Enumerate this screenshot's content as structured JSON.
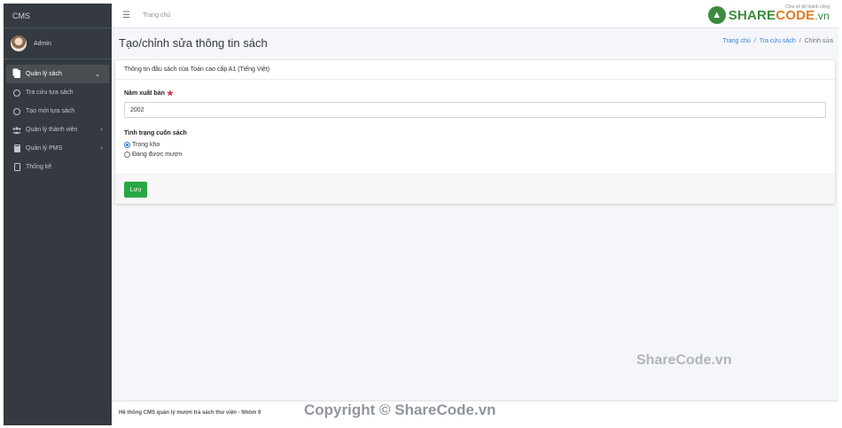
{
  "sidebar": {
    "brand": "CMS",
    "user_name": "Admin",
    "items": [
      {
        "label": "Quản lý sách",
        "icon": "books-icon",
        "active": true,
        "caret": "⌄"
      },
      {
        "label": "Tra cứu tựa sách",
        "icon": "circle-icon"
      },
      {
        "label": "Tạo mới tựa sách",
        "icon": "circle-icon"
      },
      {
        "label": "Quản lý thành viên",
        "icon": "users-icon",
        "caret": "‹"
      },
      {
        "label": "Quản lý PMS",
        "icon": "book-icon",
        "caret": "‹"
      },
      {
        "label": "Thống kê",
        "icon": "file-icon"
      }
    ]
  },
  "topbar": {
    "menu_icon": "hamburger-icon",
    "home_link": "Trang chủ",
    "logo": {
      "share": "SHARE",
      "code": "CODE",
      "vn": ".vn",
      "sub": "Chia sẻ để thành công"
    }
  },
  "content": {
    "title": "Tạo/chỉnh sửa thông tin sách",
    "breadcrumb": {
      "home": "Trang chủ",
      "search": "Tra cứu sách",
      "current": "Chỉnh sửa",
      "separator": "/"
    },
    "card": {
      "header": "Thông tin đầu sách của Toán cao cấp A1 (Tiếng Việt)",
      "year_label": "Năm xuất bản",
      "year_value": "2002",
      "status_label": "Tình trạng cuốn sách",
      "status_options": [
        {
          "label": "Trong kho",
          "checked": true
        },
        {
          "label": "Đang được mượn",
          "checked": false
        }
      ],
      "save_label": "Lưu"
    },
    "watermark": "ShareCode.vn"
  },
  "footer": {
    "text": "Hệ thống CMS quản lý mượn trả sách thư viện - Nhóm 9",
    "copyright": "Copyright © ShareCode.vn"
  },
  "colors": {
    "sidebar_bg": "#343a40",
    "accent_blue": "#2f7fd6",
    "save_green": "#28a745",
    "required_red": "#dc3545",
    "logo_green": "#3d8b3d",
    "logo_orange": "#e07b1f"
  }
}
